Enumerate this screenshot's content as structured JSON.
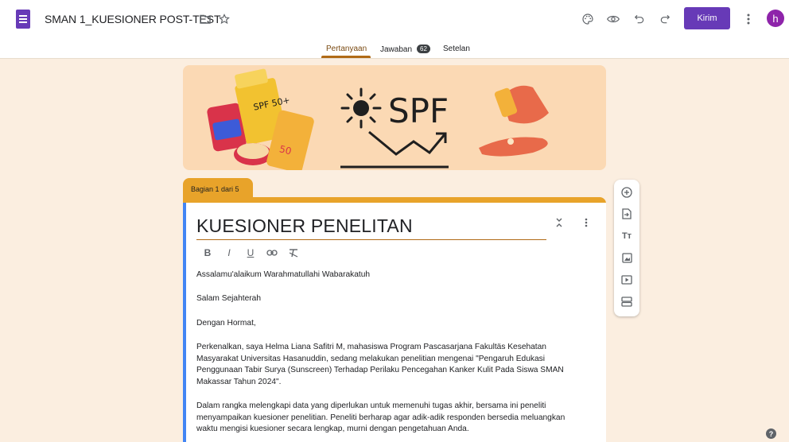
{
  "app": {
    "title": "SMAN 1_KUESIONER POST-TEST",
    "send_label": "Kirim",
    "avatar_letter": "h",
    "accent": "#673ab7"
  },
  "tabs": [
    {
      "label": "Pertanyaan",
      "active": true
    },
    {
      "label": "Jawaban",
      "count": "62"
    },
    {
      "label": "Setelan"
    }
  ],
  "banner": {
    "text": "SPF",
    "sticker_text": "SPF 50+",
    "tube_text": "50"
  },
  "section": {
    "label": "Bagian 1 dari 5"
  },
  "form": {
    "title": "KUESIONER PENELITAN",
    "paragraphs": [
      "Assalamu'alaikum Warahmatullahi Wabarakatuh",
      "Salam Sejahterah",
      "Dengan Hormat,",
      "Perkenalkan, saya Helma Liana Safitri M, mahasiswa Program Pascasarjana Fakultäs Kesehatan Masyarakat Universitas Hasanuddin, sedang melakukan penelitian mengenai \"Pengaruh Edukasi Penggunaan Tabir Surya (Sunscreen) Terhadap Perilaku Pencegahan Kanker Kulit Pada Siswa SMAN Makassar Tahun 2024\".",
      "Dalam rangka melengkapi data yang diperlukan untuk memenuhi tugas akhir, bersama ini peneliti menyampaikan kuesioner penelitian. Peneliti berharap agar adik-adik responden bersedia meluangkan waktu mengisi kuesioner secara lengkap, murni dengan pengetahuan Anda."
    ]
  },
  "format_toolbar": {
    "bold": "B",
    "italic": "I",
    "underline": "U"
  },
  "side_tools": {
    "text_icon": "Tт"
  },
  "help": {
    "label": "?"
  }
}
